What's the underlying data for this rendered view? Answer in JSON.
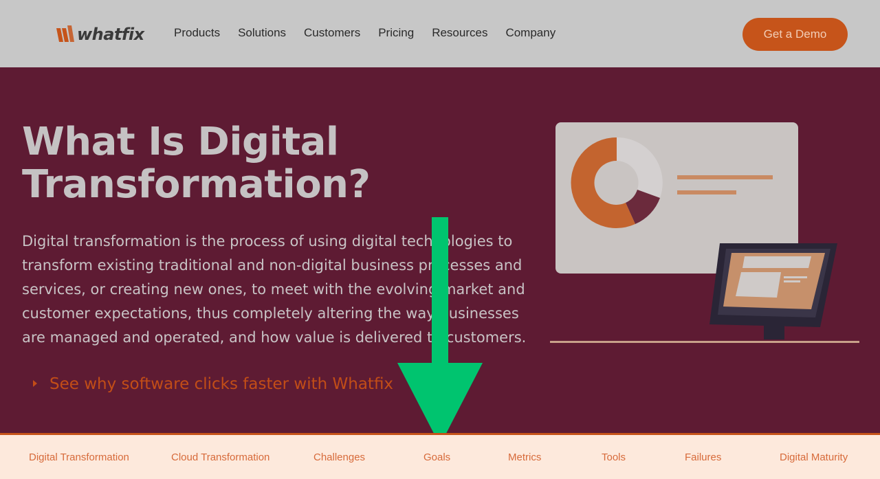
{
  "header": {
    "logo_text": "whatfix",
    "nav": [
      "Products",
      "Solutions",
      "Customers",
      "Pricing",
      "Resources",
      "Company"
    ],
    "cta": "Get a Demo"
  },
  "hero": {
    "title_line1": "What Is Digital",
    "title_line2": "Transformation?",
    "description": "Digital transformation is the process of using digital technologies to transform existing traditional and non-digital business processes and services, or creating new ones, to meet with the evolving market and customer expectations, thus completely altering the way businesses are managed and operated, and how value is delivered to customers.",
    "link": "See why software clicks faster with Whatfix"
  },
  "tabs": [
    "Digital Transformation",
    "Cloud Transformation",
    "Challenges",
    "Goals",
    "Metrics",
    "Tools",
    "Failures",
    "Digital Maturity"
  ],
  "colors": {
    "brand_orange": "#c6541a",
    "hero_bg": "#5e1b33",
    "arrow_green": "#00c46f"
  }
}
